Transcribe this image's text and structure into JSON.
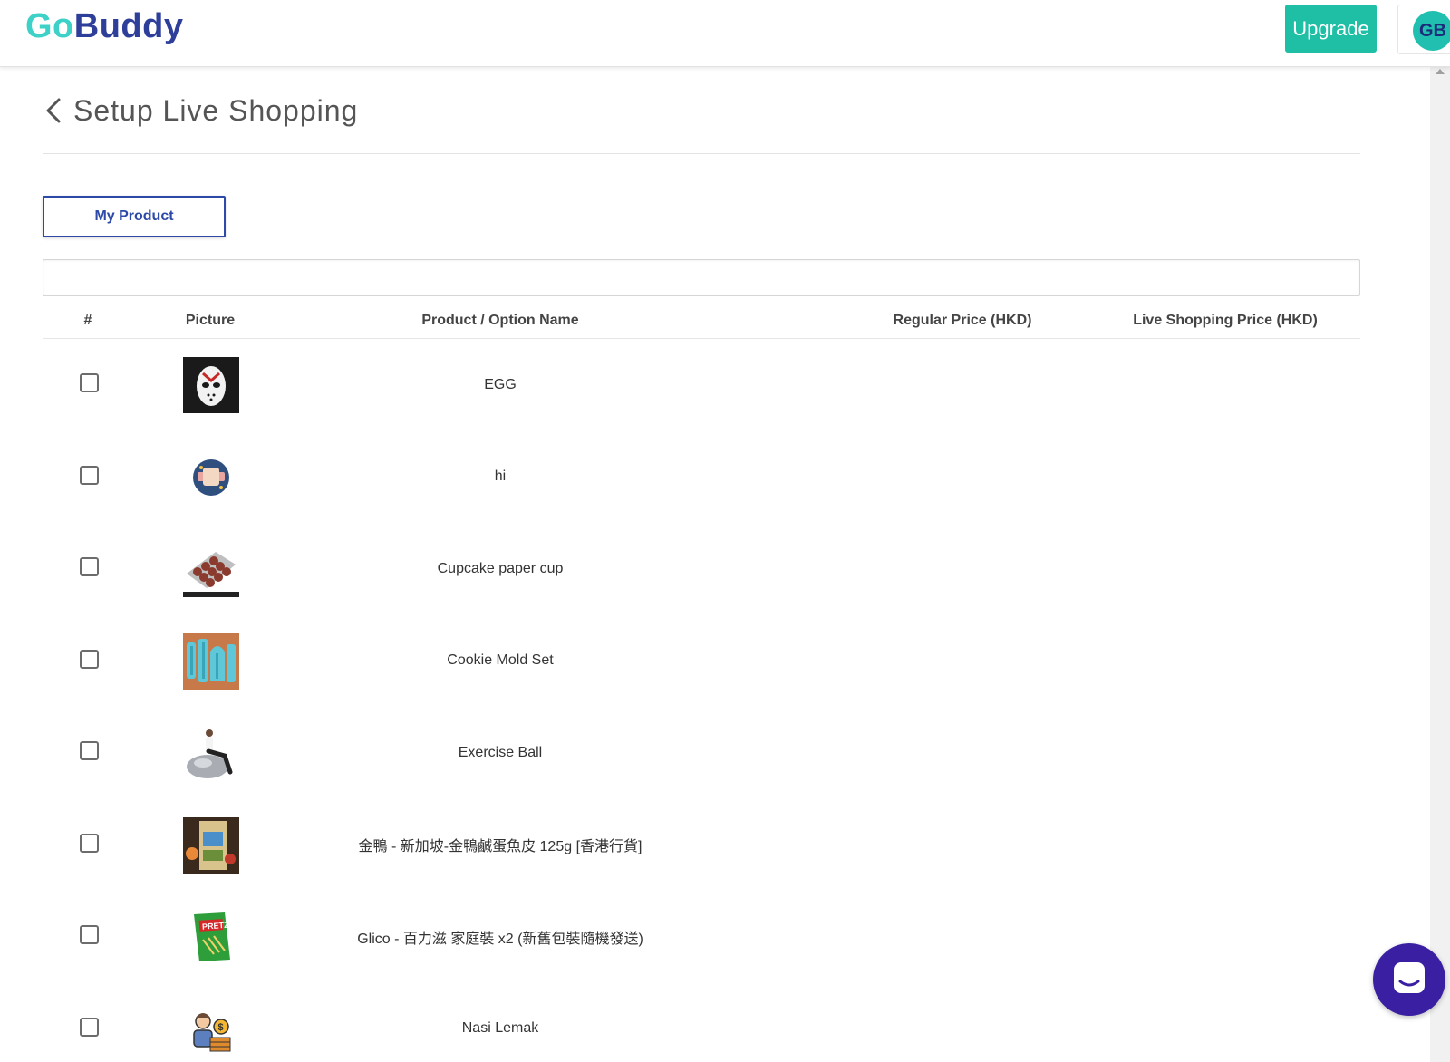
{
  "header": {
    "logo_part1": "Go",
    "logo_part2": "Buddy",
    "upgrade_label": "Upgrade",
    "avatar_initials": "GB"
  },
  "page": {
    "title": "Setup Live Shopping"
  },
  "tabs": {
    "my_product_label": "My Product"
  },
  "search": {
    "value": "",
    "placeholder": ""
  },
  "table": {
    "columns": [
      "#",
      "Picture",
      "Product / Option Name",
      "Regular Price (HKD)",
      "Live Shopping Price (HKD)"
    ],
    "rows": [
      {
        "name": "EGG",
        "image": "hockey-mask-icon",
        "regular_price": "",
        "live_price": ""
      },
      {
        "name": "hi",
        "image": "badge-circle-icon",
        "regular_price": "",
        "live_price": ""
      },
      {
        "name": "Cupcake paper cup",
        "image": "cupcake-tray-icon",
        "regular_price": "",
        "live_price": ""
      },
      {
        "name": "Cookie Mold Set",
        "image": "cookie-mold-icon",
        "regular_price": "",
        "live_price": ""
      },
      {
        "name": "Exercise Ball",
        "image": "exercise-ball-icon",
        "regular_price": "",
        "live_price": ""
      },
      {
        "name": "金鴨 - 新加坡-金鴨鹹蛋魚皮 125g [香港行貨]",
        "image": "snack-bag-icon",
        "regular_price": "",
        "live_price": ""
      },
      {
        "name": "Glico - 百力滋 家庭裝 x2 (新舊包裝隨機發送)",
        "image": "pretz-box-icon",
        "regular_price": "",
        "live_price": ""
      },
      {
        "name": "Nasi Lemak",
        "image": "money-person-icon",
        "regular_price": "",
        "live_price": ""
      }
    ]
  },
  "colors": {
    "brand_teal": "#3dd1c7",
    "brand_navy": "#2e3f9a",
    "upgrade_bg": "#1fbfa5",
    "chat_bg": "#3a1fa3"
  }
}
